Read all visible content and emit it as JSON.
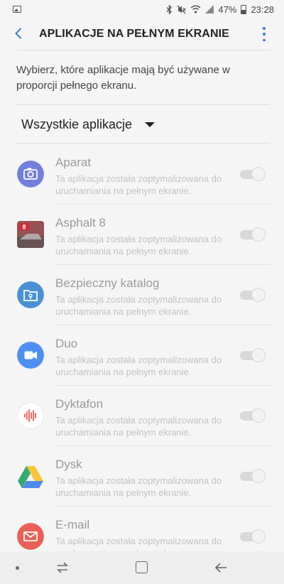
{
  "status_bar": {
    "battery": "47%",
    "time": "23:28",
    "icons": [
      "gallery-icon",
      "bluetooth-icon",
      "mute-icon",
      "wifi-icon",
      "signal-icon",
      "battery-icon"
    ]
  },
  "header": {
    "title": "APLIKACJE NA PEŁNYM EKRANIE",
    "icons": [
      "back-arrow-icon",
      "more-options-icon"
    ],
    "accent_color": "#3a7ec6"
  },
  "description": "Wybierz, które aplikacje mają być używane w proporcji pełnego ekranu.",
  "filter": {
    "selected": "Wszystkie aplikacje"
  },
  "apps": [
    {
      "name": "Aparat",
      "description": "Ta aplikacja została zoptymalizowana do uruchamiania na pełnym ekranie.",
      "icon": "camera-icon",
      "color": "#5b6bd8"
    },
    {
      "name": "Asphalt 8",
      "description": "Ta aplikacja została zoptymalizowana do uruchamiania na pełnym ekranie.",
      "icon": "asphalt-8-icon",
      "color": "#c0392b"
    },
    {
      "name": "Bezpieczny katalog",
      "description": "Ta aplikacja została zoptymalizowana do uruchamiania na pełnym ekranie.",
      "icon": "secure-folder-icon",
      "color": "#2a7fcf"
    },
    {
      "name": "Duo",
      "description": "Ta aplikacja została zoptymalizowana do uruchamiania na pełnym ekranie.",
      "icon": "duo-icon",
      "color": "#2f7df1"
    },
    {
      "name": "Dyktafon",
      "description": "Ta aplikacja została zoptymalizowana do uruchamiania na pełnym ekranie.",
      "icon": "voice-recorder-icon",
      "color": "#e0443a"
    },
    {
      "name": "Dysk",
      "description": "Ta aplikacja została zoptymalizowana do uruchamiania na pełnym ekranie.",
      "icon": "google-drive-icon",
      "color": "#1ea362"
    },
    {
      "name": "E-mail",
      "description": "Ta aplikacja została zoptymalizowana do uruchamiania na pełnym ekranie.",
      "icon": "email-icon",
      "color": "#e8453c"
    }
  ],
  "nav_bar": {
    "icons": [
      "nav-dot-icon",
      "recents-icon",
      "home-icon",
      "back-icon"
    ]
  }
}
